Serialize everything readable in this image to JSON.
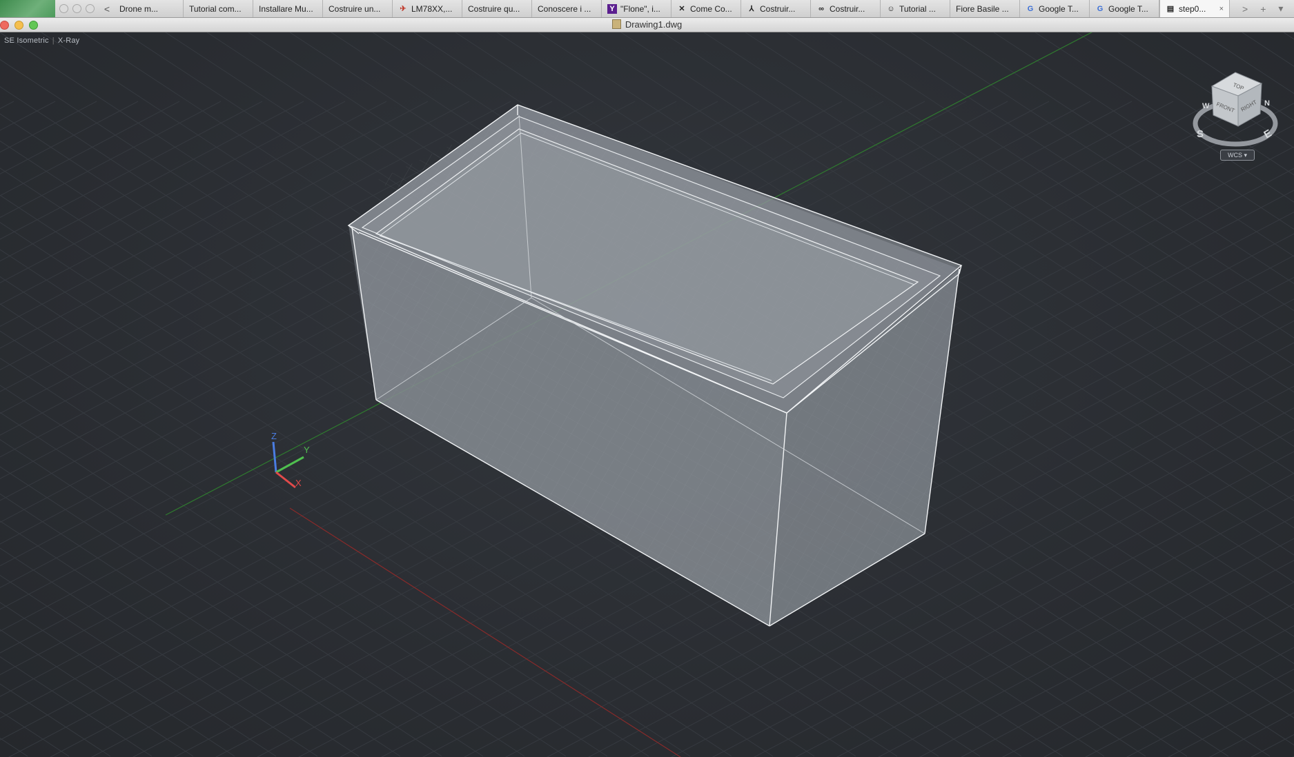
{
  "browser": {
    "tabs": [
      {
        "label": "Drone m...",
        "icon": "none"
      },
      {
        "label": "Tutorial com...",
        "icon": "none"
      },
      {
        "label": "Installare Mu...",
        "icon": "none"
      },
      {
        "label": "Costruire un...",
        "icon": "none"
      },
      {
        "label": "LM78XX,...",
        "icon": "plane-icon"
      },
      {
        "label": "Costruire qu...",
        "icon": "none"
      },
      {
        "label": "Conoscere i ...",
        "icon": "none"
      },
      {
        "label": "\"Flone\", i...",
        "icon": "yahoo-icon",
        "glyph": "Y"
      },
      {
        "label": "Come Co...",
        "icon": "drone-icon",
        "glyph": "✕"
      },
      {
        "label": "Costruir...",
        "icon": "figure-icon",
        "glyph": "⅄"
      },
      {
        "label": "Costruir...",
        "icon": "glasses-icon",
        "glyph": "∞"
      },
      {
        "label": "Tutorial ...",
        "icon": "person-icon",
        "glyph": "☺"
      },
      {
        "label": "Fiore Basile ...",
        "icon": "none"
      },
      {
        "label": "Google T...",
        "icon": "google-translate-icon",
        "glyph": "G"
      },
      {
        "label": "Google T...",
        "icon": "google-translate-icon",
        "glyph": "G"
      },
      {
        "label": "step0...",
        "icon": "document-icon",
        "glyph": "▤",
        "active": true
      }
    ],
    "back_glyph": "<",
    "forward_glyph": ">",
    "new_tab_glyph": "+",
    "menu_glyph": "▾",
    "close_glyph": "×"
  },
  "window": {
    "title": "Drawing1.dwg"
  },
  "viewport": {
    "view_name": "SE Isometric",
    "visual_style": "X-Ray",
    "ucs_labels": {
      "x": "X",
      "y": "Y",
      "z": "Z"
    },
    "viewcube": {
      "faces": {
        "top": "TOP",
        "front": "FRONT",
        "right": "RIGHT"
      },
      "compass": {
        "north": "N",
        "south": "S",
        "east": "E",
        "west": "W"
      }
    },
    "wcs_label": "WCS"
  },
  "colors": {
    "viewport_bg": "#2b2e33",
    "grid_line": "#363a40",
    "axis_x": "#8a2a2a",
    "axis_y": "#2f7a2f",
    "box_fill": "#8e949b",
    "box_edge": "#f2f4f6",
    "ucs_x": "#e24a4a",
    "ucs_y": "#4fbf4f",
    "ucs_z": "#4a7de2"
  }
}
